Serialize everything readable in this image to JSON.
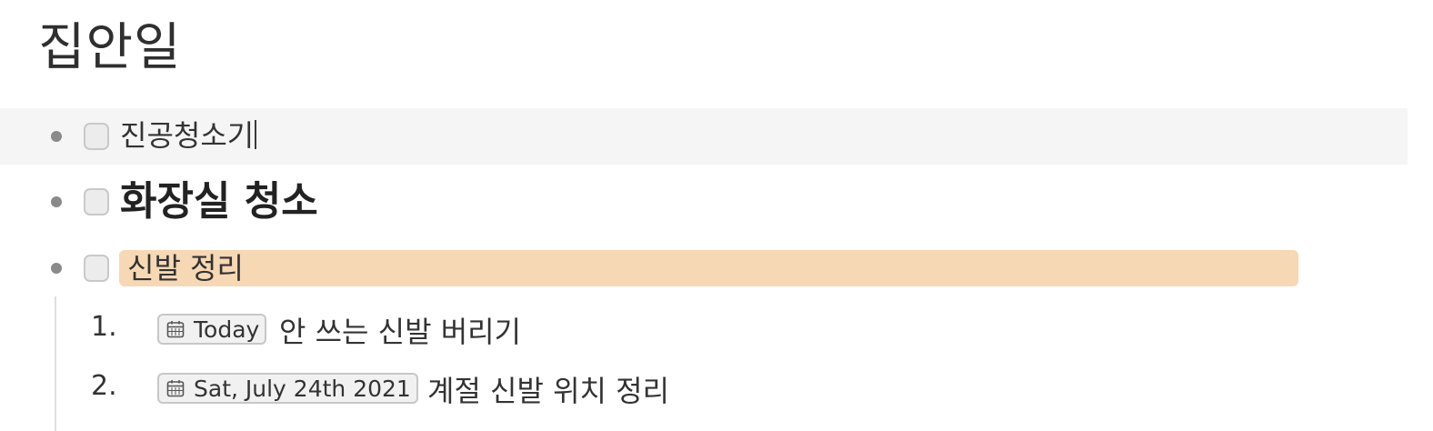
{
  "page": {
    "title": "집안일"
  },
  "tasks": [
    {
      "label": "진공청소기",
      "checked": false,
      "style": "normal",
      "focused": true
    },
    {
      "label": "화장실 청소",
      "checked": false,
      "style": "bold"
    },
    {
      "label": "신발 정리",
      "checked": false,
      "style": "highlight",
      "highlight_color": "#f7d8b5"
    }
  ],
  "subtasks": [
    {
      "number": "1.",
      "date": "Today",
      "label": "안 쓰는 신발 버리기"
    },
    {
      "number": "2.",
      "date": "Sat, July 24th 2021",
      "label": "계절 신발 위치 정리"
    }
  ],
  "icons": {
    "bullet": "bullet-dot-icon",
    "checkbox": "checkbox-icon",
    "date": "calendar-icon"
  },
  "colors": {
    "hover_row": "#f5f5f5",
    "highlight": "#f7d8b5",
    "bullet": "#8a8a8a"
  }
}
